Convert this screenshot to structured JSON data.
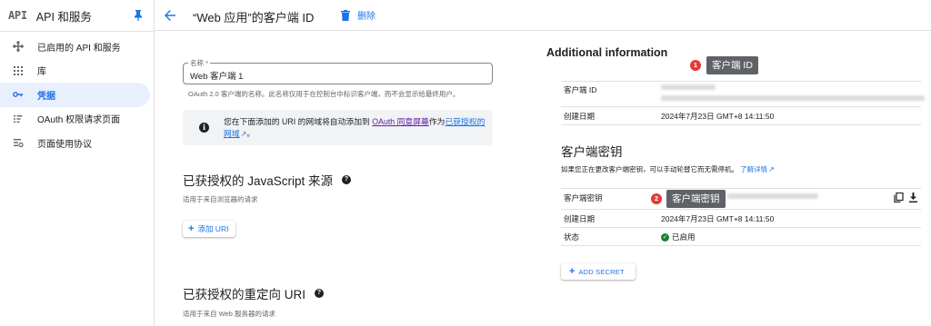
{
  "sidebar": {
    "logo": "API",
    "title": "API 和服务",
    "items": [
      {
        "label": "已启用的 API 和服务",
        "icon": "diamond-nodes-icon"
      },
      {
        "label": "库",
        "icon": "library-grid-icon"
      },
      {
        "label": "凭据",
        "icon": "key-icon",
        "active": true
      },
      {
        "label": "OAuth 权限请求页面",
        "icon": "consent-list-icon"
      },
      {
        "label": "页面使用协议",
        "icon": "settings-list-icon"
      }
    ]
  },
  "header": {
    "title": "“Web 应用”的客户端 ID",
    "delete_label": "删除"
  },
  "form": {
    "name_label": "名称 *",
    "name_value": "Web 客户端 1",
    "name_hint": "OAuth 2.0 客户端的名称。此名称仅用于在控制台中标识客户端，而不会显示给最终用户。",
    "info_prefix": "您在下面添加的 URI 的网域将自动添加到",
    "info_link1": "OAuth 同意屏幕",
    "info_middle": "作为",
    "info_link2": "已获授权的网域",
    "info_suffix": "。",
    "js_origins_title": "已获授权的 JavaScript 来源",
    "js_origins_hint": "适用于来自浏览器的请求",
    "add_uri_label": "添加 URI",
    "redirect_title": "已获授权的重定向 URI",
    "redirect_hint": "适用于来自 Web 服务器的请求"
  },
  "additional": {
    "title": "Additional information",
    "client_id_label": "客户端 ID",
    "created_label": "创建日期",
    "created_value": "2024年7月23日 GMT+8 14:11:50"
  },
  "secrets": {
    "title": "客户端密钥",
    "desc": "如果您正在更改客户端密钥，可以手动轮替它而无需停机。",
    "learn_more": "了解详情",
    "secret_label": "客户端密钥",
    "created_label": "创建日期",
    "created_value": "2024年7月23日 GMT+8 14:11:50",
    "status_label": "状态",
    "status_value": "已启用",
    "add_secret_label": "ADD SECRET"
  },
  "annotations": [
    {
      "number": "1",
      "text": "客户端 ID"
    },
    {
      "number": "2",
      "text": "客户端密钥"
    }
  ],
  "colors": {
    "accent": "#1a73e8",
    "active_bg": "#e8f0fe",
    "badge": "#e53935",
    "callout": "#5f6368",
    "success": "#188038"
  }
}
